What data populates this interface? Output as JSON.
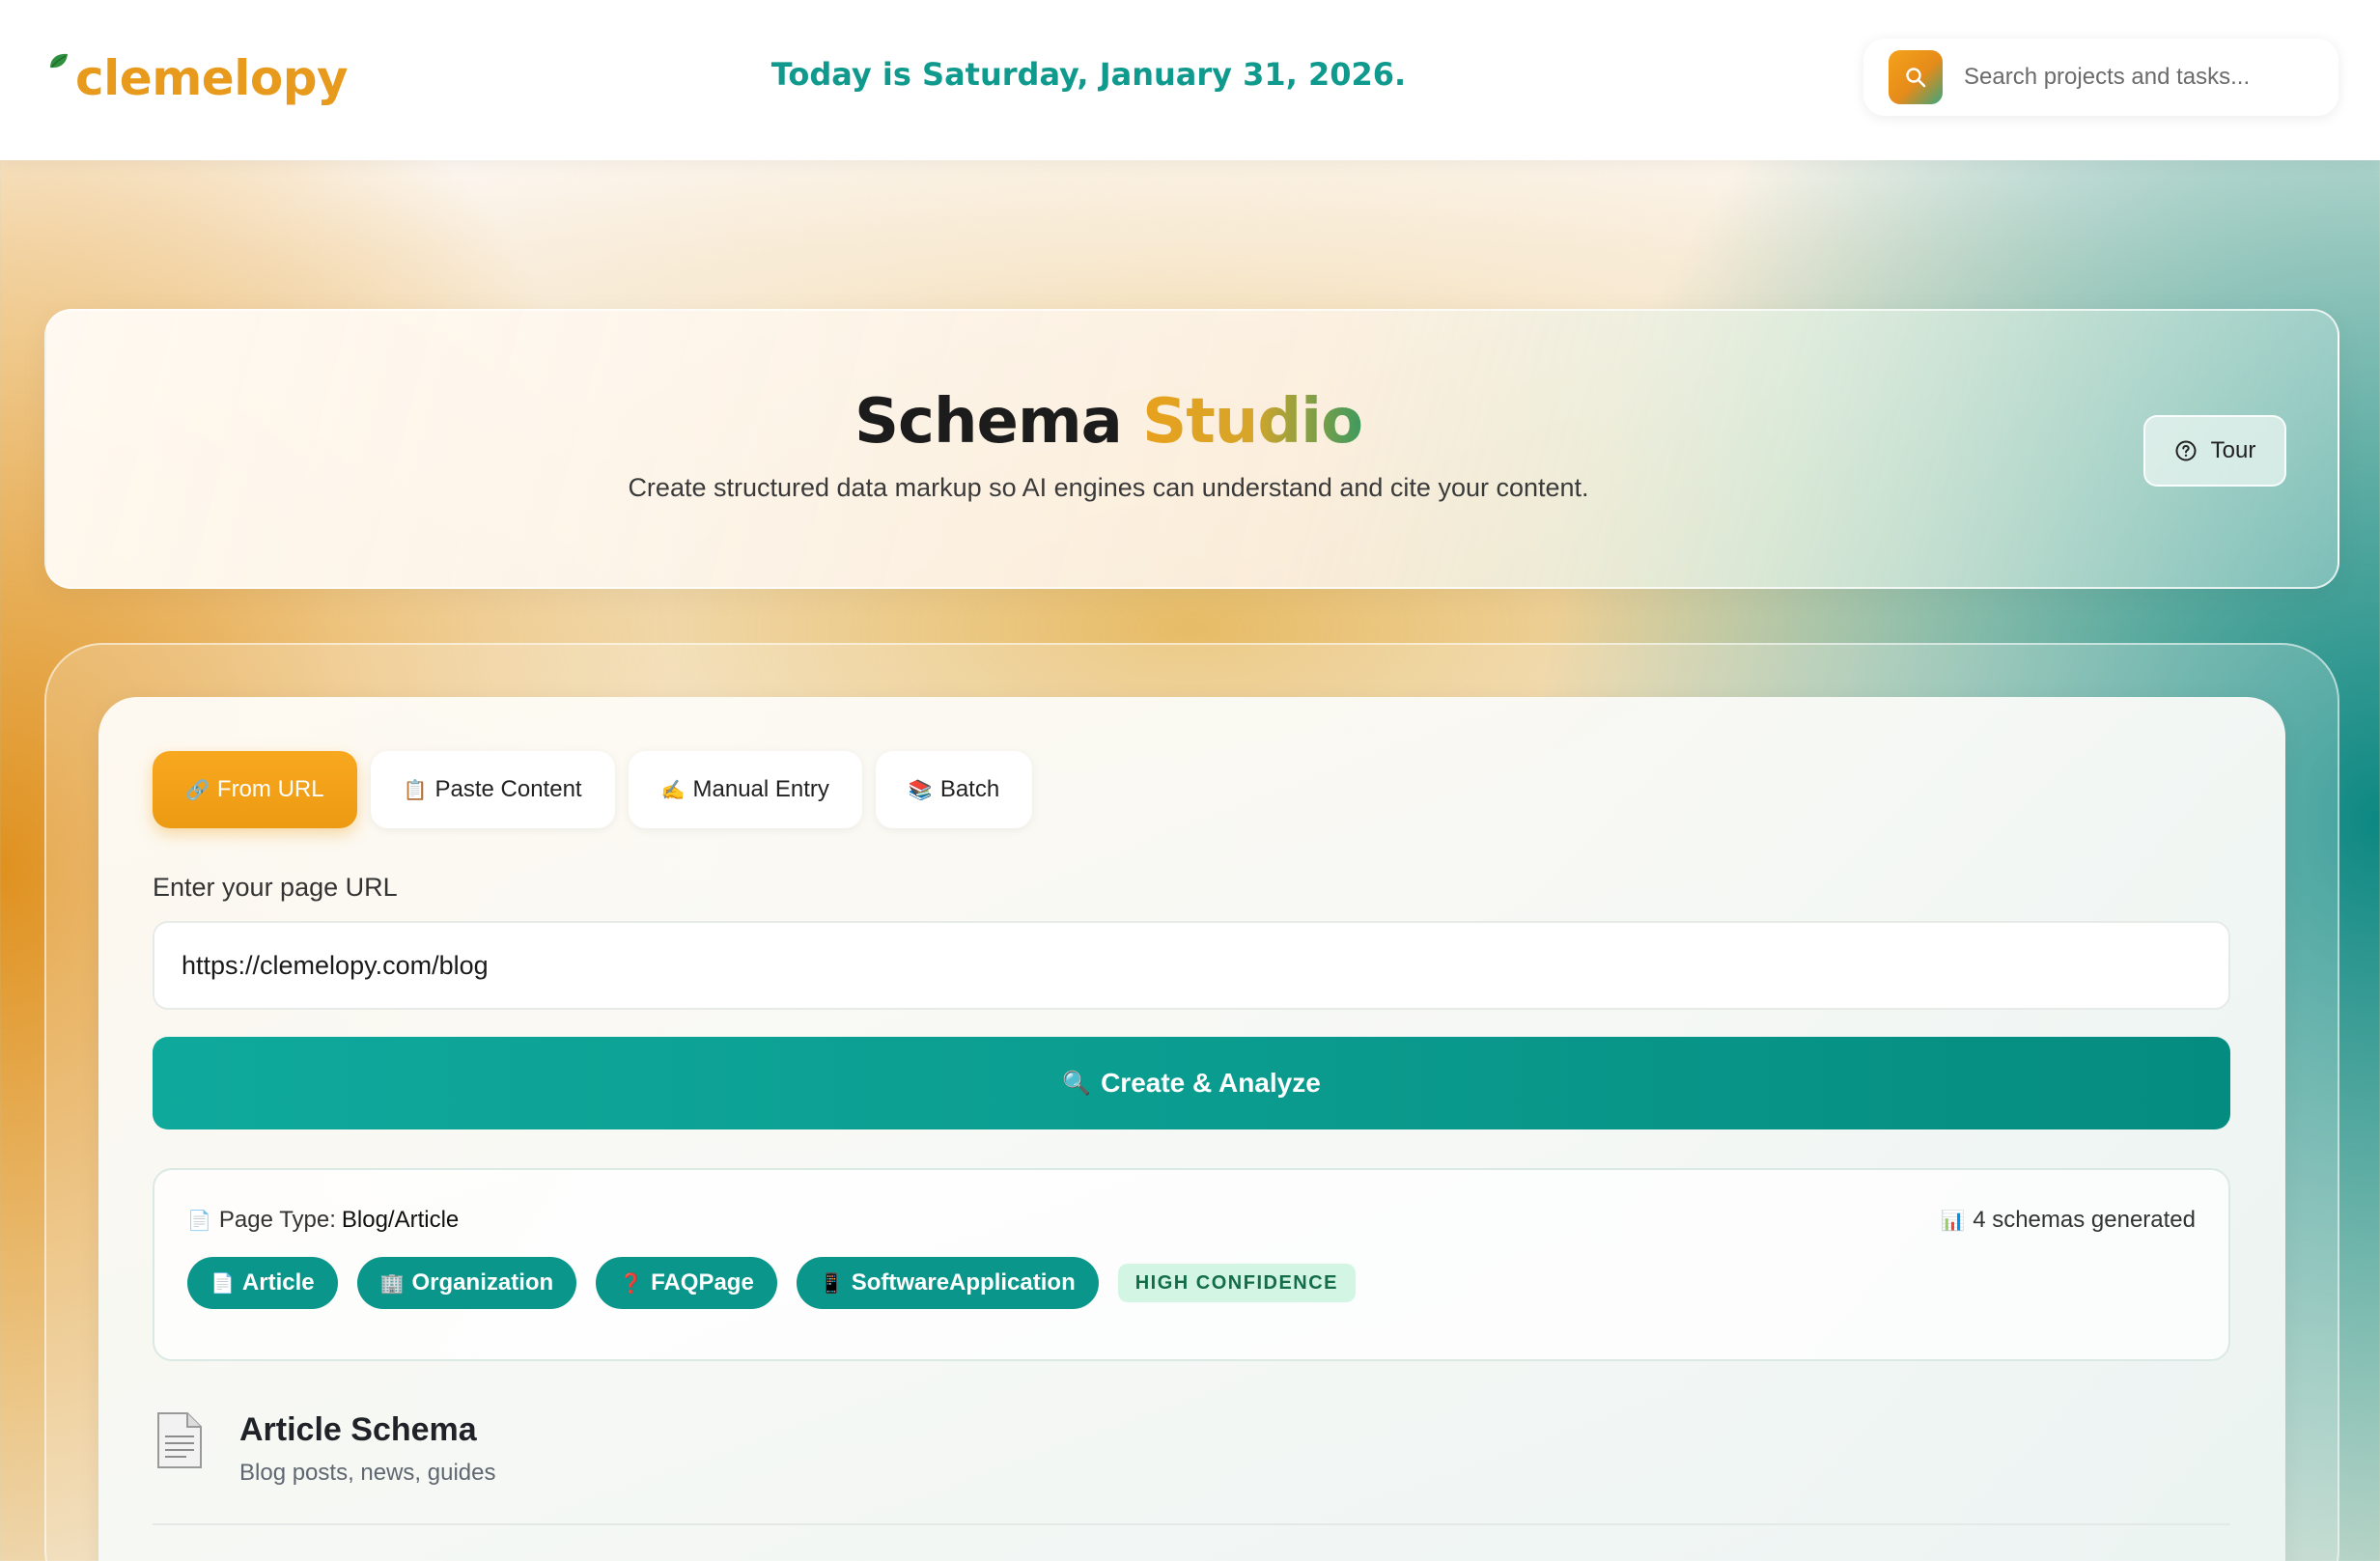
{
  "header": {
    "logo_text": "clemelopy",
    "date_text": "Today is Saturday, January 31, 2026.",
    "search": {
      "placeholder": "Search projects and tasks..."
    }
  },
  "hero": {
    "title_part1": "Schema",
    "title_part2": "Studio",
    "subtitle": "Create structured data markup so AI engines can understand and cite your content.",
    "tour_label": "Tour"
  },
  "tabs": [
    {
      "icon": "🔗",
      "label": "From URL",
      "active": true
    },
    {
      "icon": "📋",
      "label": "Paste Content",
      "active": false
    },
    {
      "icon": "✍️",
      "label": "Manual Entry",
      "active": false
    },
    {
      "icon": "📚",
      "label": "Batch",
      "active": false
    }
  ],
  "form": {
    "url_label": "Enter your page URL",
    "url_value": "https://clemelopy.com/blog",
    "submit_icon": "🔍",
    "submit_label": "Create & Analyze"
  },
  "result": {
    "page_type_icon": "📄",
    "page_type_label": "Page Type:",
    "page_type_value": "Blog/Article",
    "count_icon": "📊",
    "count_text": "4 schemas generated",
    "schemas": [
      {
        "icon": "📄",
        "label": "Article"
      },
      {
        "icon": "🏢",
        "label": "Organization"
      },
      {
        "icon": "❓",
        "label": "FAQPage"
      },
      {
        "icon": "📱",
        "label": "SoftwareApplication"
      }
    ],
    "confidence": "HIGH CONFIDENCE"
  },
  "section": {
    "icon": "document-icon",
    "title": "Article Schema",
    "subtitle": "Blog posts, news, guides"
  },
  "colors": {
    "brand_orange": "#e89a1c",
    "brand_teal": "#0a968a",
    "date_teal": "#0f9a8d"
  }
}
